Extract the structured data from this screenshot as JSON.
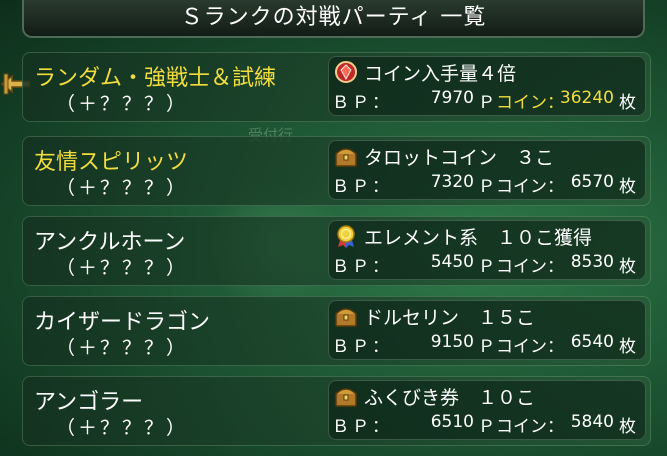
{
  "header": {
    "title": "Ｓランクの対戦パーティ 一覧"
  },
  "background": {
    "faint_sign": "受付行"
  },
  "labels": {
    "bp": "ＢＰ：",
    "bp_unit": "Ｐ",
    "coin": "コイン：",
    "coin_unit": "枚"
  },
  "parties": [
    {
      "name": "ランダム・強戦士＆試練",
      "stat": "（＋？？？）",
      "reward": "コイン入手量４倍",
      "reward_icon": "red-gem-icon",
      "bp": "7970",
      "coins": "36240",
      "selected": true
    },
    {
      "name": "友情スピリッツ",
      "stat": "（＋？？？）",
      "reward": "タロットコイン　３こ",
      "reward_icon": "treasure-chest-icon",
      "bp": "7320",
      "coins": "6570",
      "name_highlight": true
    },
    {
      "name": "アンクルホーン",
      "stat": "（＋？？？）",
      "reward": "エレメント系　１０こ獲得",
      "reward_icon": "gold-medal-icon",
      "bp": "5450",
      "coins": "8530"
    },
    {
      "name": "カイザードラゴン",
      "stat": "（＋？？？）",
      "reward": "ドルセリン　１５こ",
      "reward_icon": "treasure-chest-icon",
      "bp": "9150",
      "coins": "6540"
    },
    {
      "name": "アンゴラー",
      "stat": "（＋？？？）",
      "reward": "ふくびき券　１０こ",
      "reward_icon": "treasure-chest-icon",
      "bp": "6510",
      "coins": "5840"
    }
  ],
  "colors": {
    "highlight": "#f2dd3c",
    "text": "#ffffff"
  }
}
